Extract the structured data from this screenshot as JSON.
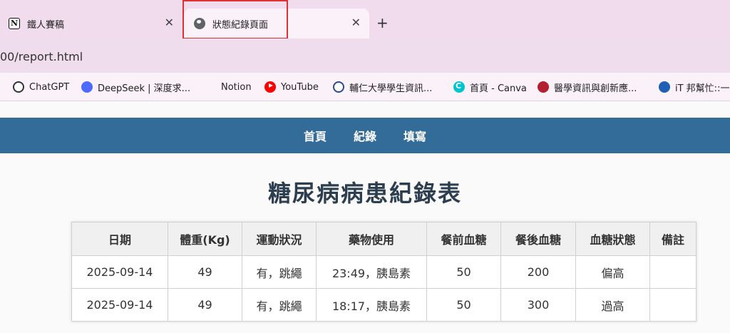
{
  "browser": {
    "tabs": [
      {
        "title": "鐵人賽稿",
        "icon": "notion-icon",
        "active": false
      },
      {
        "title": "狀態紀錄頁面",
        "icon": "globe-icon",
        "active": true
      }
    ],
    "tab_close_glyph": "✕",
    "new_tab_glyph": "+",
    "url": "00/report.html",
    "bookmarks": [
      {
        "label": "ChatGPT",
        "icon": "chatgpt-icon"
      },
      {
        "label": "DeepSeek | 深度求...",
        "icon": "deepseek-icon"
      },
      {
        "label": "Notion",
        "icon": "notion-icon"
      },
      {
        "label": "YouTube",
        "icon": "youtube-icon"
      },
      {
        "label": "輔仁大學學生資訊...",
        "icon": "fju-icon"
      },
      {
        "label": "首頁 - Canva",
        "icon": "canva-icon"
      },
      {
        "label": "醫學資訊與創新應...",
        "icon": "tmu-icon"
      },
      {
        "label": "iT 邦幫忙::一起",
        "icon": "ithome-icon"
      }
    ]
  },
  "nav": {
    "items": [
      "首頁",
      "紀錄",
      "填寫"
    ]
  },
  "page": {
    "title": "糖尿病病患紀錄表"
  },
  "table": {
    "headers": [
      "日期",
      "體重(Kg)",
      "運動狀況",
      "藥物使用",
      "餐前血糖",
      "餐後血糖",
      "血糖狀態",
      "備註"
    ],
    "rows": [
      [
        "2025-09-14",
        "49",
        "有，跳繩",
        "23:49，胰島素",
        "50",
        "200",
        "偏高",
        ""
      ],
      [
        "2025-09-14",
        "49",
        "有，跳繩",
        "18:17，胰島素",
        "50",
        "300",
        "過高",
        ""
      ]
    ]
  },
  "colors": {
    "nav_bg": "#336b99",
    "title": "#2c3e50",
    "highlight": "#e03030"
  }
}
